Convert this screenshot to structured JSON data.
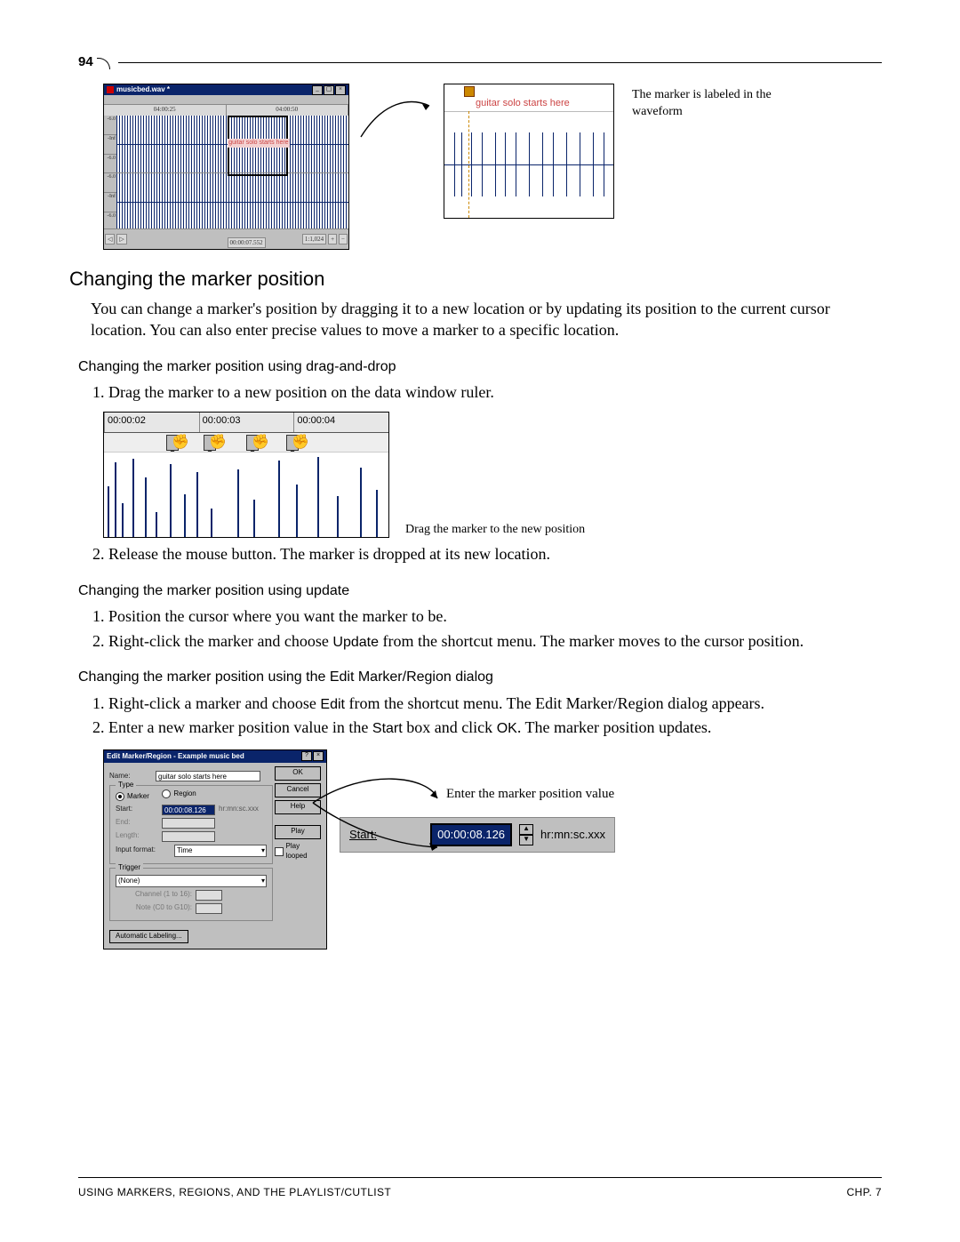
{
  "page_number": "94",
  "fig1": {
    "window_title": "musicbed.wav *",
    "ruler": [
      "04:00:25",
      "04:00:50"
    ],
    "labels": [
      "-6.0",
      "-Inf",
      "-6.0",
      "-6.0",
      "-Inf",
      "-6.0"
    ],
    "marker_text": "guitar solo starts here",
    "status_zoom": "1:1,024",
    "status_time": "00:00:07.552",
    "caption": "The marker is labeled in the waveform",
    "zoom_marker_text": "guitar solo starts here"
  },
  "h_changing": "Changing the marker position",
  "p_changing": "You can change a marker's position by dragging it to a new location or by updating its position to the current cursor location. You can also enter precise values to move a marker to a specific location.",
  "h_drag": "Changing the marker position using drag-and-drop",
  "step_drag_1": "Drag the marker to a new position on the data window ruler.",
  "fig2": {
    "ticks": [
      "00:00:02",
      "00:00:03",
      "00:00:04"
    ],
    "caption": "Drag the marker to the new position"
  },
  "step_drag_2": "Release the mouse button. The marker is dropped at its new location.",
  "h_update": "Changing the marker position using update",
  "step_upd_1": "Position the cursor where you want the marker to be.",
  "step_upd_2a": "Right-click the marker and choose ",
  "step_upd_2b": "Update",
  "step_upd_2c": " from the shortcut menu. The marker moves to the cursor position.",
  "h_dialog": "Changing the marker position using the Edit Marker/Region dialog",
  "step_dlg_1a": "Right-click a marker and choose ",
  "step_dlg_1b": "Edit",
  "step_dlg_1c": " from the shortcut menu. The Edit Marker/Region dialog appears.",
  "step_dlg_2a": "Enter a new marker position value in the ",
  "step_dlg_2b": "Start",
  "step_dlg_2c": " box and click ",
  "step_dlg_2d": "OK",
  "step_dlg_2e": ". The marker position updates.",
  "dialog": {
    "title": "Edit Marker/Region - Example music bed",
    "name_label": "Name:",
    "name_value": "guitar solo starts here",
    "type_label": "Type",
    "radio_marker": "Marker",
    "radio_region": "Region",
    "start_label": "Start:",
    "start_value": "00:00:08.126",
    "start_unit": "hr:mn:sc.xxx",
    "end_label": "End:",
    "length_label": "Length:",
    "input_format_label": "Input format:",
    "input_format_value": "Time",
    "trigger_label": "Trigger",
    "trigger_value": "(None)",
    "chan_label": "Channel (1 to 16):",
    "note_label": "Note (C0 to G10):",
    "btn_ok": "OK",
    "btn_cancel": "Cancel",
    "btn_help": "Help",
    "btn_play": "Play",
    "chk_play_looped": "Play looped",
    "btn_auto": "Automatic Labeling..."
  },
  "callout": {
    "text": "Enter the marker position value",
    "label": "Start:",
    "value": "00:00:08.126",
    "unit": "hr:mn:sc.xxx"
  },
  "footer_left": "USING MARKERS, REGIONS, AND THE PLAYLIST/CUTLIST",
  "footer_right": "CHP. 7"
}
